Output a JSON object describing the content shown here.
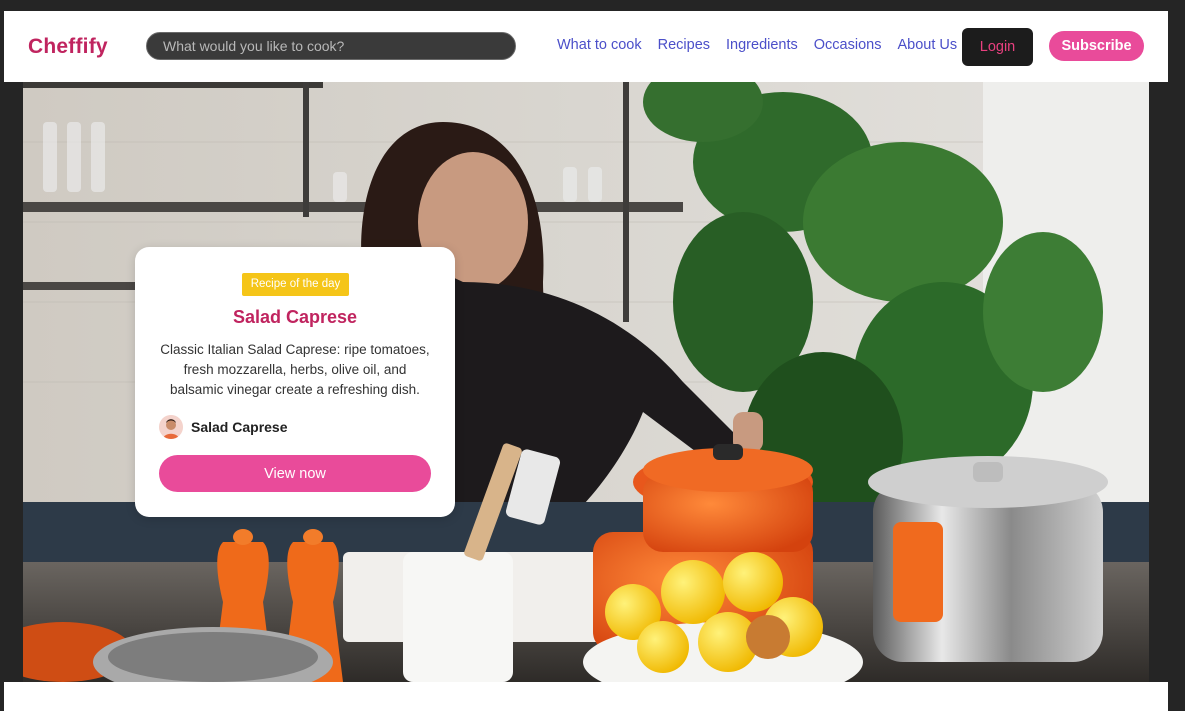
{
  "brand": {
    "name": "Cheffify",
    "color": "#c0245f"
  },
  "search": {
    "placeholder": "What would you like to cook?"
  },
  "nav": {
    "items": [
      {
        "label": "What to cook"
      },
      {
        "label": "Recipes"
      },
      {
        "label": "Ingredients"
      },
      {
        "label": "Occasions"
      },
      {
        "label": "About Us"
      }
    ]
  },
  "auth": {
    "login_label": "Login",
    "subscribe_label": "Subscribe"
  },
  "hero": {
    "card": {
      "badge": "Recipe of the day",
      "title": "Salad Caprese",
      "description": "Classic Italian Salad Caprese: ripe tomatoes, fresh mozzarella, herbs, olive oil, and balsamic vinegar create a refreshing dish.",
      "author_name": "Salad Caprese",
      "cta_label": "View now"
    }
  },
  "colors": {
    "accent_pink": "#e94b9a",
    "nav_link": "#4b4fc9",
    "badge_yellow": "#f5c518",
    "login_bg": "#1c1c1c"
  }
}
